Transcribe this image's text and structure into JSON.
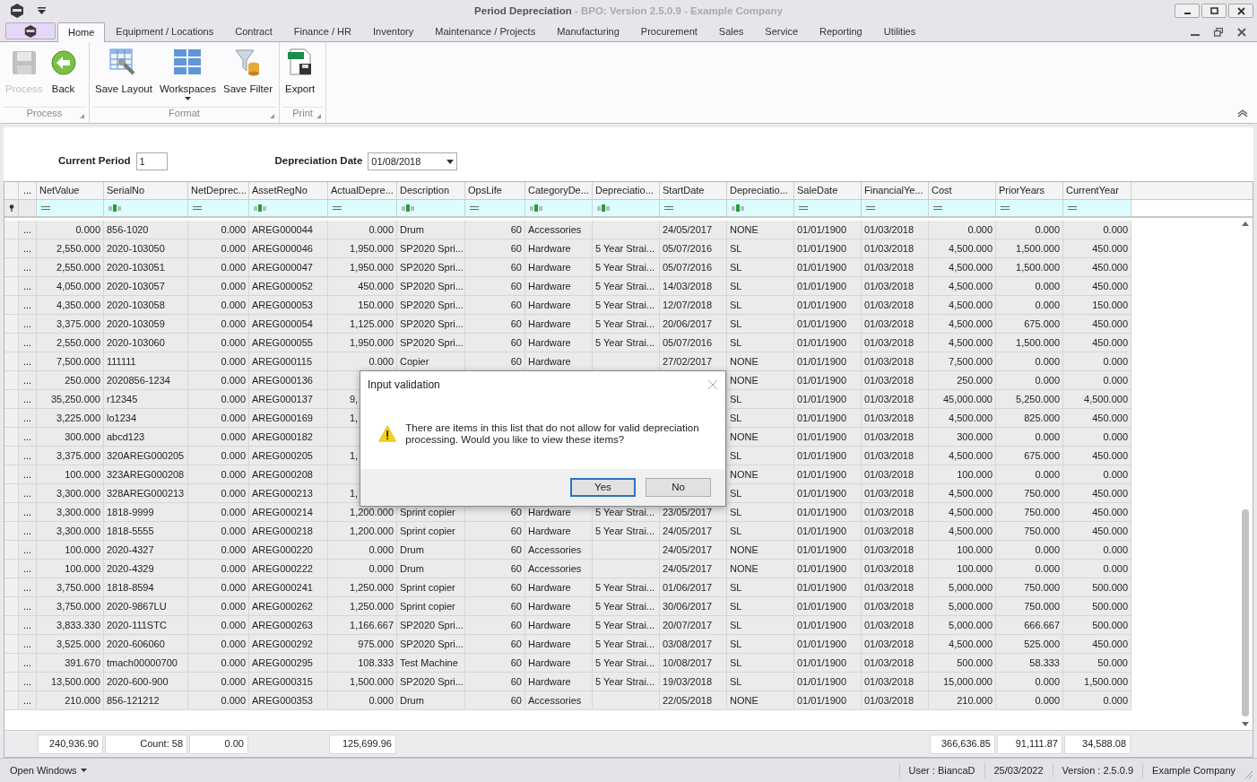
{
  "window": {
    "title": "Period Depreciation",
    "subtitle": " - BPO: Version 2.5.0.9 - Example Company"
  },
  "tabs": [
    {
      "label": "Home",
      "selected": true
    },
    {
      "label": "Equipment / Locations",
      "selected": false
    },
    {
      "label": "Contract",
      "selected": false
    },
    {
      "label": "Finance / HR",
      "selected": false
    },
    {
      "label": "Inventory",
      "selected": false
    },
    {
      "label": "Maintenance / Projects",
      "selected": false
    },
    {
      "label": "Manufacturing",
      "selected": false
    },
    {
      "label": "Procurement",
      "selected": false
    },
    {
      "label": "Sales",
      "selected": false
    },
    {
      "label": "Service",
      "selected": false
    },
    {
      "label": "Reporting",
      "selected": false
    },
    {
      "label": "Utilities",
      "selected": false
    }
  ],
  "ribbon_groups": [
    {
      "label": "Process",
      "buttons": [
        {
          "label": "Process",
          "kind": "save",
          "disabled": true
        },
        {
          "label": "Back",
          "kind": "back",
          "disabled": false
        }
      ]
    },
    {
      "label": "Format",
      "buttons": [
        {
          "label": "Save Layout",
          "kind": "layout",
          "disabled": false
        },
        {
          "label": "Workspaces",
          "kind": "workspaces",
          "disabled": false,
          "dropdown": true
        },
        {
          "label": "Save Filter",
          "kind": "filter",
          "disabled": false
        }
      ]
    },
    {
      "label": "Print",
      "buttons": [
        {
          "label": "Export",
          "kind": "export",
          "disabled": false
        }
      ]
    }
  ],
  "form": {
    "current_period_label": "Current Period",
    "current_period": "1",
    "date_label": "Depreciation Date",
    "date": "01/08/2018"
  },
  "table": {
    "columns": [
      {
        "label": "..."
      },
      {
        "label": "NetValue",
        "kind": "number",
        "summary": "240,936.90"
      },
      {
        "label": "SerialNo",
        "kind": "text",
        "summary": "Count: 58"
      },
      {
        "label": "NetDeprec...",
        "kind": "number",
        "summary": "0.00"
      },
      {
        "label": "AssetRegNo",
        "kind": "text"
      },
      {
        "label": "ActualDepre...",
        "kind": "number",
        "summary": "125,699.96"
      },
      {
        "label": "Description",
        "kind": "text"
      },
      {
        "label": "OpsLife",
        "kind": "number"
      },
      {
        "label": "CategoryDe...",
        "kind": "text"
      },
      {
        "label": "Depreciatio...",
        "kind": "text"
      },
      {
        "label": "StartDate",
        "kind": "date"
      },
      {
        "label": "Depreciatio...",
        "kind": "text"
      },
      {
        "label": "SaleDate",
        "kind": "date"
      },
      {
        "label": "FinancialYe...",
        "kind": "date"
      },
      {
        "label": "Cost",
        "kind": "number",
        "summary": "366,636.85"
      },
      {
        "label": "PriorYears",
        "kind": "number",
        "summary": "91,111.87"
      },
      {
        "label": "CurrentYear",
        "kind": "number",
        "summary": "34,588.08"
      }
    ],
    "rows": [
      {
        "covered": false,
        "cells": [
          "...",
          "0.000",
          "856-1020",
          "0.000",
          "AREG000044",
          "0.000",
          "Drum",
          "60",
          "Accessories",
          null,
          "24/05/2017",
          "NONE",
          "01/01/1900",
          "01/03/2018",
          "0.000",
          "0.000",
          "0.000"
        ]
      },
      {
        "covered": false,
        "cells": [
          "...",
          "2,550.000",
          "2020-103050",
          "0.000",
          "AREG000046",
          "1,950.000",
          "SP2020 Spri...",
          "60",
          "Hardware",
          "5 Year Strai...",
          "05/07/2016",
          "SL",
          "01/01/1900",
          "01/03/2018",
          "4,500.000",
          "1,500.000",
          "450.000"
        ]
      },
      {
        "covered": false,
        "cells": [
          "...",
          "2,550.000",
          "2020-103051",
          "0.000",
          "AREG000047",
          "1,950.000",
          "SP2020 Spri...",
          "60",
          "Hardware",
          "5 Year Strai...",
          "05/07/2016",
          "SL",
          "01/01/1900",
          "01/03/2018",
          "4,500.000",
          "1,500.000",
          "450.000"
        ]
      },
      {
        "covered": false,
        "cells": [
          "...",
          "4,050.000",
          "2020-103057",
          "0.000",
          "AREG000052",
          "450.000",
          "SP2020 Spri...",
          "60",
          "Hardware",
          "5 Year Strai...",
          "14/03/2018",
          "SL",
          "01/01/1900",
          "01/03/2018",
          "4,500.000",
          "0.000",
          "450.000"
        ]
      },
      {
        "covered": false,
        "cells": [
          "...",
          "4,350.000",
          "2020-103058",
          "0.000",
          "AREG000053",
          "150.000",
          "SP2020 Spri...",
          "60",
          "Hardware",
          "5 Year Strai...",
          "12/07/2018",
          "SL",
          "01/01/1900",
          "01/03/2018",
          "4,500.000",
          "0.000",
          "150.000"
        ]
      },
      {
        "covered": false,
        "cells": [
          "...",
          "3,375.000",
          "2020-103059",
          "0.000",
          "AREG000054",
          "1,125.000",
          "SP2020 Spri...",
          "60",
          "Hardware",
          "5 Year Strai...",
          "20/06/2017",
          "SL",
          "01/01/1900",
          "01/03/2018",
          "4,500.000",
          "675.000",
          "450.000"
        ]
      },
      {
        "covered": false,
        "cells": [
          "...",
          "2,550.000",
          "2020-103060",
          "0.000",
          "AREG000055",
          "1,950.000",
          "SP2020 Spri...",
          "60",
          "Hardware",
          "5 Year Strai...",
          "05/07/2016",
          "SL",
          "01/01/1900",
          "01/03/2018",
          "4,500.000",
          "1,500.000",
          "450.000"
        ]
      },
      {
        "covered": false,
        "cells": [
          "...",
          "7,500.000",
          "111111",
          "0.000",
          "AREG000115",
          "0.000",
          "Copier",
          "60",
          "Hardware",
          null,
          "27/02/2017",
          "NONE",
          "01/01/1900",
          "01/03/2018",
          "7,500.000",
          "0.000",
          "0.000"
        ]
      },
      {
        "cells": [
          "...",
          "250.000",
          "2020856-1234",
          "0.000",
          "AREG000136",
          null,
          null,
          null,
          null,
          null,
          null,
          "NONE",
          "01/01/1900",
          "01/03/2018",
          "250.000",
          "0.000",
          "0.000"
        ]
      },
      {
        "covered": true,
        "cells": [
          "...",
          "35,250.000",
          "r12345",
          "0.000",
          "AREG000137",
          "9,",
          null,
          null,
          null,
          null,
          null,
          "SL",
          "01/01/1900",
          "01/03/2018",
          "45,000.000",
          "5,250.000",
          "4,500.000"
        ]
      },
      {
        "covered": true,
        "cells": [
          "...",
          "3,225.000",
          "lo1234",
          "0.000",
          "AREG000169",
          "1,",
          null,
          null,
          null,
          null,
          null,
          "SL",
          "01/01/1900",
          "01/03/2018",
          "4,500.000",
          "825.000",
          "450.000"
        ]
      },
      {
        "cells": [
          "...",
          "300.000",
          "abcd123",
          "0.000",
          "AREG000182",
          null,
          null,
          null,
          null,
          null,
          null,
          "NONE",
          "01/01/1900",
          "01/03/2018",
          "300.000",
          "0.000",
          "0.000"
        ]
      },
      {
        "covered": true,
        "cells": [
          "...",
          "3,375.000",
          "320AREG000205",
          "0.000",
          "AREG000205",
          "1,",
          null,
          null,
          null,
          null,
          null,
          "SL",
          "01/01/1900",
          "01/03/2018",
          "4,500.000",
          "675.000",
          "450.000"
        ]
      },
      {
        "cells": [
          "...",
          "100.000",
          "323AREG000208",
          "0.000",
          "AREG000208",
          null,
          null,
          null,
          null,
          null,
          null,
          "NONE",
          "01/01/1900",
          "01/03/2018",
          "100.000",
          "0.000",
          "0.000"
        ]
      },
      {
        "covered": true,
        "cells": [
          "...",
          "3,300.000",
          "328AREG000213",
          "0.000",
          "AREG000213",
          "1,",
          null,
          null,
          null,
          null,
          null,
          "SL",
          "01/01/1900",
          "01/03/2018",
          "4,500.000",
          "750.000",
          "450.000"
        ]
      },
      {
        "covered": false,
        "cells": [
          "...",
          "3,300.000",
          "1818-9999",
          "0.000",
          "AREG000214",
          "1,200.000",
          "Sprint copier",
          "60",
          "Hardware",
          "5 Year Strai...",
          "23/05/2017",
          "SL",
          "01/01/1900",
          "01/03/2018",
          "4,500.000",
          "750.000",
          "450.000"
        ]
      },
      {
        "covered": false,
        "cells": [
          "...",
          "3,300.000",
          "1818-5555",
          "0.000",
          "AREG000218",
          "1,200.000",
          "Sprint copier",
          "60",
          "Hardware",
          "5 Year Strai...",
          "24/05/2017",
          "SL",
          "01/01/1900",
          "01/03/2018",
          "4,500.000",
          "750.000",
          "450.000"
        ]
      },
      {
        "covered": false,
        "cells": [
          "...",
          "100.000",
          "2020-4327",
          "0.000",
          "AREG000220",
          "0.000",
          "Drum",
          "60",
          "Accessories",
          null,
          "24/05/2017",
          "NONE",
          "01/01/1900",
          "01/03/2018",
          "100.000",
          "0.000",
          "0.000"
        ]
      },
      {
        "covered": false,
        "cells": [
          "...",
          "100.000",
          "2020-4329",
          "0.000",
          "AREG000222",
          "0.000",
          "Drum",
          "60",
          "Accessories",
          null,
          "24/05/2017",
          "NONE",
          "01/01/1900",
          "01/03/2018",
          "100.000",
          "0.000",
          "0.000"
        ]
      },
      {
        "covered": false,
        "cells": [
          "...",
          "3,750.000",
          "1818-8594",
          "0.000",
          "AREG000241",
          "1,250.000",
          "Sprint copier",
          "60",
          "Hardware",
          "5 Year Strai...",
          "01/06/2017",
          "SL",
          "01/01/1900",
          "01/03/2018",
          "5,000.000",
          "750.000",
          "500.000"
        ]
      },
      {
        "covered": false,
        "cells": [
          "...",
          "3,750.000",
          "2020-9867LU",
          "0.000",
          "AREG000262",
          "1,250.000",
          "Sprint copier",
          "60",
          "Hardware",
          "5 Year Strai...",
          "30/06/2017",
          "SL",
          "01/01/1900",
          "01/03/2018",
          "5,000.000",
          "750.000",
          "500.000"
        ]
      },
      {
        "covered": false,
        "cells": [
          "...",
          "3,833.330",
          "2020-111STC",
          "0.000",
          "AREG000263",
          "1,166.667",
          "SP2020 Spri...",
          "60",
          "Hardware",
          "5 Year Strai...",
          "20/07/2017",
          "SL",
          "01/01/1900",
          "01/03/2018",
          "5,000.000",
          "666.667",
          "500.000"
        ]
      },
      {
        "covered": false,
        "cells": [
          "...",
          "3,525.000",
          "2020-606060",
          "0.000",
          "AREG000292",
          "975.000",
          "SP2020 Spri...",
          "60",
          "Hardware",
          "5 Year Strai...",
          "03/08/2017",
          "SL",
          "01/01/1900",
          "01/03/2018",
          "4,500.000",
          "525.000",
          "450.000"
        ]
      },
      {
        "covered": false,
        "cells": [
          "...",
          "391.670",
          "tmach00000700",
          "0.000",
          "AREG000295",
          "108.333",
          "Test Machine",
          "60",
          "Hardware",
          "5 Year Strai...",
          "10/08/2017",
          "SL",
          "01/01/1900",
          "01/03/2018",
          "500.000",
          "58.333",
          "50.000"
        ]
      },
      {
        "covered": false,
        "cells": [
          "...",
          "13,500.000",
          "2020-600-900",
          "0.000",
          "AREG000315",
          "1,500.000",
          "SP2020 Spri...",
          "60",
          "Hardware",
          "5 Year Strai...",
          "19/03/2018",
          "SL",
          "01/01/1900",
          "01/03/2018",
          "15,000.000",
          "0.000",
          "1,500.000"
        ]
      },
      {
        "covered": false,
        "cells": [
          "...",
          "210.000",
          "856-121212",
          "0.000",
          "AREG000353",
          "0.000",
          "Drum",
          "60",
          "Accessories",
          null,
          "22/05/2018",
          "NONE",
          "01/01/1900",
          "01/03/2018",
          "210.000",
          "0.000",
          "0.000"
        ]
      }
    ]
  },
  "dialog": {
    "title": "Input validation",
    "message": "There are items in this list that do not allow for valid depreciation processing. Would you like to view these items?",
    "buttons": [
      {
        "label": "Yes",
        "selected": true
      },
      {
        "label": "No",
        "selected": false
      }
    ]
  },
  "status_bar": {
    "open_windows": "Open Windows",
    "user": "User : BiancaD",
    "date": "25/03/2022",
    "version": "Version : 2.5.0.9",
    "company": "Example Company"
  }
}
